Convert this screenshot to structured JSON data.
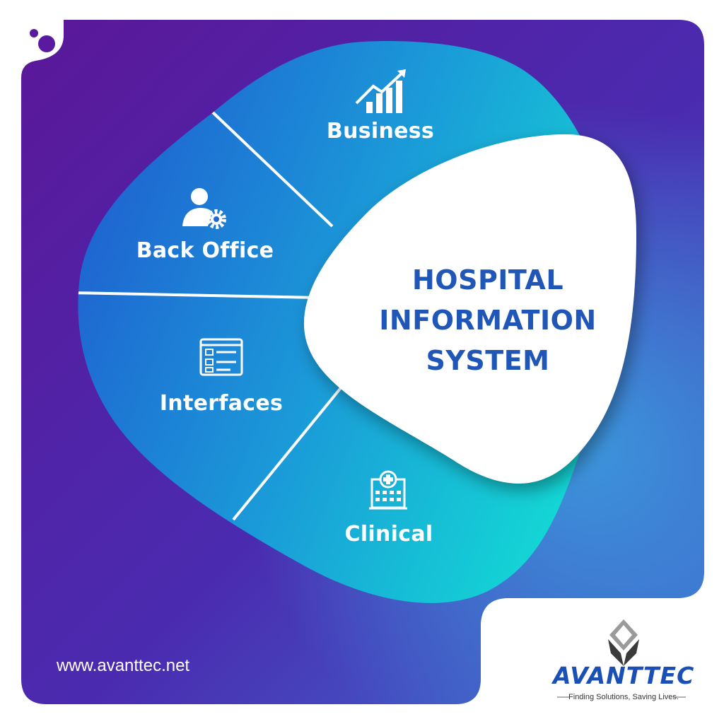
{
  "diagram": {
    "center": {
      "title_lines": [
        "HOSPITAL",
        "INFORMATION",
        "SYSTEM"
      ]
    },
    "segments": [
      {
        "label": "Business",
        "icon": "growth-chart-icon"
      },
      {
        "label": "Back Office",
        "icon": "user-gear-icon"
      },
      {
        "label": "Interfaces",
        "icon": "window-list-icon"
      },
      {
        "label": "Clinical",
        "icon": "hospital-building-icon"
      }
    ]
  },
  "footer": {
    "website": "www.avanttec.net"
  },
  "logo": {
    "name": "AVANTTEC",
    "tagline": "Finding Solutions, Saving Lives."
  },
  "colors": {
    "background_purple": "#5a1aa0",
    "segment_blue": "#1f68d0",
    "segment_teal": "#10d8d2",
    "title_blue": "#1f56b8"
  }
}
